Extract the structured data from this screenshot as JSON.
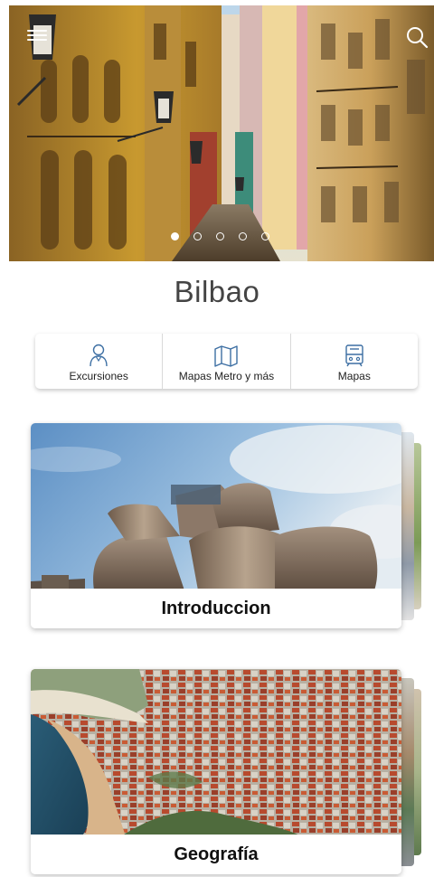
{
  "header": {
    "menu_icon": "hamburger-menu-icon",
    "search_icon": "search-icon",
    "carousel": {
      "total": 5,
      "active_index": 0
    }
  },
  "city": {
    "name": "Bilbao"
  },
  "segments": [
    {
      "label": "Excursiones",
      "icon": "person-icon"
    },
    {
      "label": "Mapas Metro y más",
      "icon": "map-icon"
    },
    {
      "label": "Mapas",
      "icon": "tram-icon"
    }
  ],
  "cards": [
    {
      "title": "Introduccion"
    },
    {
      "title": "Geografía"
    }
  ],
  "colors": {
    "icon_blue": "#3d6fa3",
    "title_gray": "#444444",
    "card_title": "#111111"
  }
}
